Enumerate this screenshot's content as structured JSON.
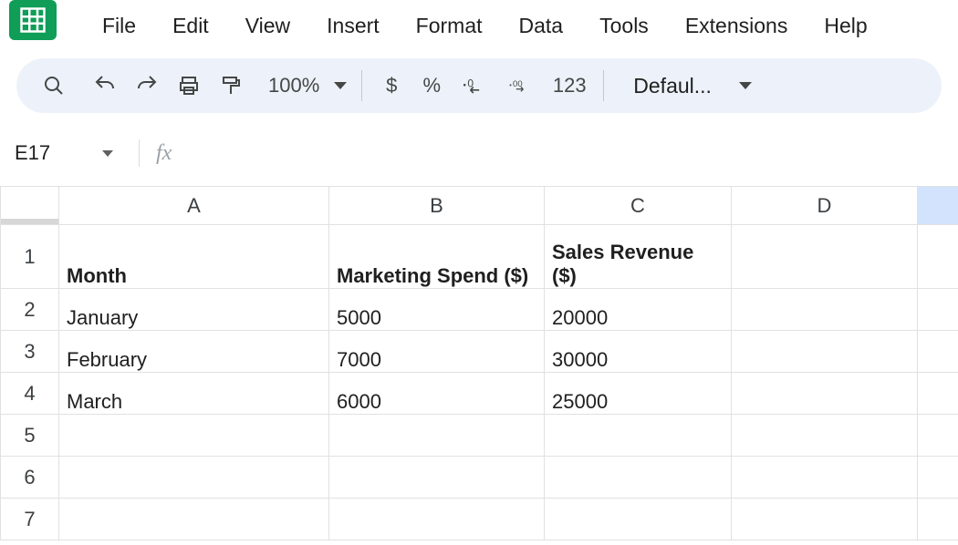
{
  "menu": {
    "file": "File",
    "edit": "Edit",
    "view": "View",
    "insert": "Insert",
    "format": "Format",
    "data": "Data",
    "tools": "Tools",
    "extensions": "Extensions",
    "help": "Help"
  },
  "toolbar": {
    "zoom": "100%",
    "currency": "$",
    "percent": "%",
    "decrease_decimal": ".0",
    "increase_decimal": ".00",
    "more_formats": "123",
    "font": "Defaul..."
  },
  "namebox": {
    "cell_ref": "E17"
  },
  "columns": [
    "A",
    "B",
    "C",
    "D",
    ""
  ],
  "rows": [
    {
      "num": "1",
      "cells": [
        "Month",
        "Marketing Spend ($)",
        "Sales Revenue ($)",
        "",
        ""
      ],
      "bold": true
    },
    {
      "num": "2",
      "cells": [
        "January",
        "5000",
        "20000",
        "",
        ""
      ],
      "bold": false
    },
    {
      "num": "3",
      "cells": [
        "February",
        "7000",
        "30000",
        "",
        ""
      ],
      "bold": false
    },
    {
      "num": "4",
      "cells": [
        "March",
        "6000",
        "25000",
        "",
        ""
      ],
      "bold": false
    },
    {
      "num": "5",
      "cells": [
        "",
        "",
        "",
        "",
        ""
      ],
      "bold": false
    },
    {
      "num": "6",
      "cells": [
        "",
        "",
        "",
        "",
        ""
      ],
      "bold": false
    },
    {
      "num": "7",
      "cells": [
        "",
        "",
        "",
        "",
        ""
      ],
      "bold": false
    }
  ]
}
